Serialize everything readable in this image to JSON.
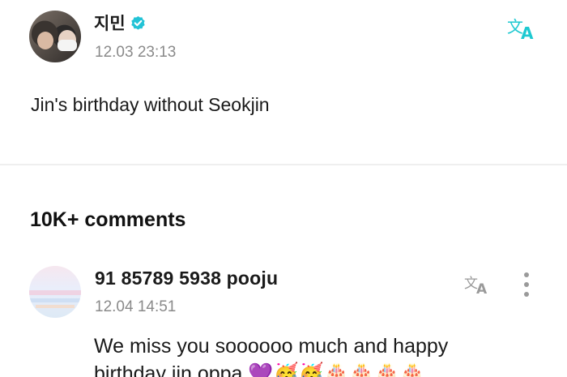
{
  "post": {
    "author": "지민",
    "date": "12.03 23:13",
    "text": "Jin's birthday without Seokjin"
  },
  "comments": {
    "heading": "10K+ comments",
    "items": [
      {
        "author": "91 85789 5938  pooju",
        "date": "12.04 14:51",
        "text_line1": "We miss you soooooo much and happy",
        "text_line2": "birthday jin oppa",
        "emojis": "💜🥳🥳🎂🎂🎂🎂"
      }
    ]
  },
  "colors": {
    "accent": "#1ec9d1",
    "verified": "#22c3d6",
    "muted": "#8a8a8a"
  },
  "icons": {
    "verified": "verified-badge-icon",
    "translate": "translate-icon",
    "more": "more-vertical-icon"
  }
}
